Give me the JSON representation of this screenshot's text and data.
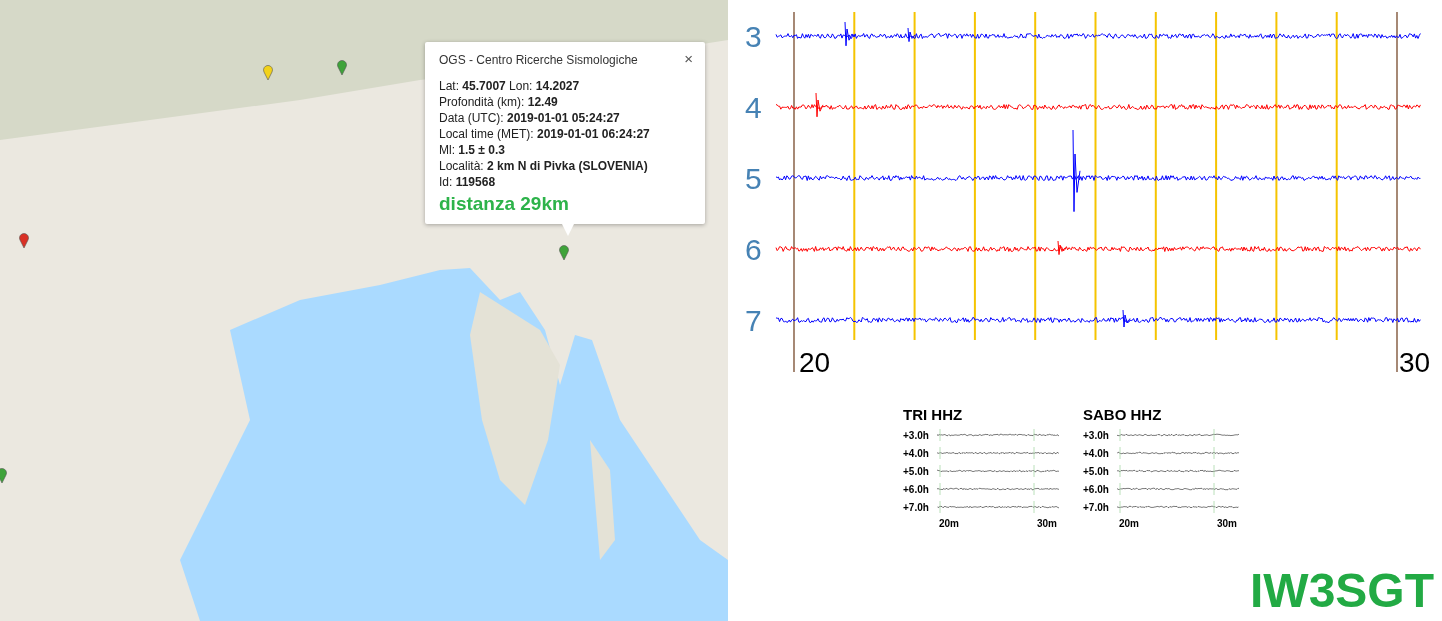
{
  "map": {
    "markers": [
      {
        "color": "#f2d21a"
      },
      {
        "color": "#3fa33a"
      },
      {
        "color": "#d93025"
      },
      {
        "color": "#3fa33a"
      },
      {
        "color": "#3fa33a"
      }
    ],
    "popup": {
      "title": "OGS - Centro Ricerche Sismologiche",
      "close": "×",
      "lines": [
        "Lat: **45.7007** Lon: **14.2027**",
        "Profondità (km): **12.49**",
        "Data (UTC): **2019-01-01 05:24:27**",
        "Local time (MET): **2019-01-01 06:24:27**",
        "Ml: **1.5 ± 0.3**",
        "Località: **2 km N di Pivka (SLOVENIA)**",
        "Id: **119568**"
      ],
      "distance": "distanza 29km"
    }
  },
  "seismogram": {
    "traces": [
      {
        "label": "3",
        "color": "#0000ff"
      },
      {
        "label": "4",
        "color": "#ff0000"
      },
      {
        "label": "5",
        "color": "#0000ff"
      },
      {
        "label": "6",
        "color": "#ff0000"
      },
      {
        "label": "7",
        "color": "#0000ff"
      }
    ],
    "xticks": [
      "20",
      "30"
    ]
  },
  "helicorders": [
    {
      "title": "TRI HHZ",
      "rows": [
        "+3.0h",
        "+4.0h",
        "+5.0h",
        "+6.0h",
        "+7.0h"
      ],
      "xlabels": [
        "20m",
        "30m"
      ]
    },
    {
      "title": "SABO HHZ",
      "rows": [
        "+3.0h",
        "+4.0h",
        "+5.0h",
        "+6.0h",
        "+7.0h"
      ],
      "xlabels": [
        "20m",
        "30m"
      ]
    }
  ],
  "callsign": "IW3SGT"
}
